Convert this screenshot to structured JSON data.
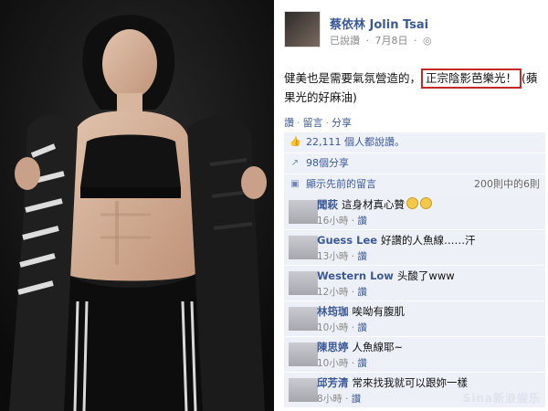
{
  "post": {
    "author": "蔡依林 Jolin Tsai",
    "meta_text": "已說讚",
    "date": "7月8日",
    "text_before": "健美也是需要氣氛營造的，",
    "highlight": "正宗陰影芭樂光！",
    "text_after": "(蘋果光的好麻油)"
  },
  "actions": {
    "like": "讚",
    "comment": "留言",
    "share": "分享"
  },
  "stats": {
    "likes_text": "22,111 個人都說讚。",
    "shares_text": "98個分享",
    "previous_comments_text": "顯示先前的留言",
    "comments_count_text": "200則中的6則"
  },
  "comments": [
    {
      "name": "聞萩",
      "text": "這身材真心贊",
      "time": "16小時",
      "like": "讚",
      "emoji_count": 2
    },
    {
      "name": "Guess Lee",
      "text": "好讚的人魚線……汗",
      "time": "13小時",
      "like": "讚"
    },
    {
      "name": "Western Low",
      "text": "头酸了www",
      "time": "12小時",
      "like": "讚"
    },
    {
      "name": "林筠珈",
      "text": "唉呦有腹肌",
      "time": "10小時",
      "like": "讚"
    },
    {
      "name": "陳思婷",
      "text": "人魚線耶~",
      "time": "10小時",
      "like": "讚"
    },
    {
      "name": "邱芳清",
      "text": "常來找我就可以跟妳一樣",
      "time": "8小時",
      "like": "讚"
    }
  ],
  "watermark": "Sina新浪娱乐",
  "colors": {
    "link": "#3b5998",
    "row_bg": "#eef1f8",
    "highlight_border": "#c62828"
  },
  "icons": {
    "thumb": "thumbs-up-icon",
    "share": "share-icon",
    "comments": "comments-icon"
  }
}
